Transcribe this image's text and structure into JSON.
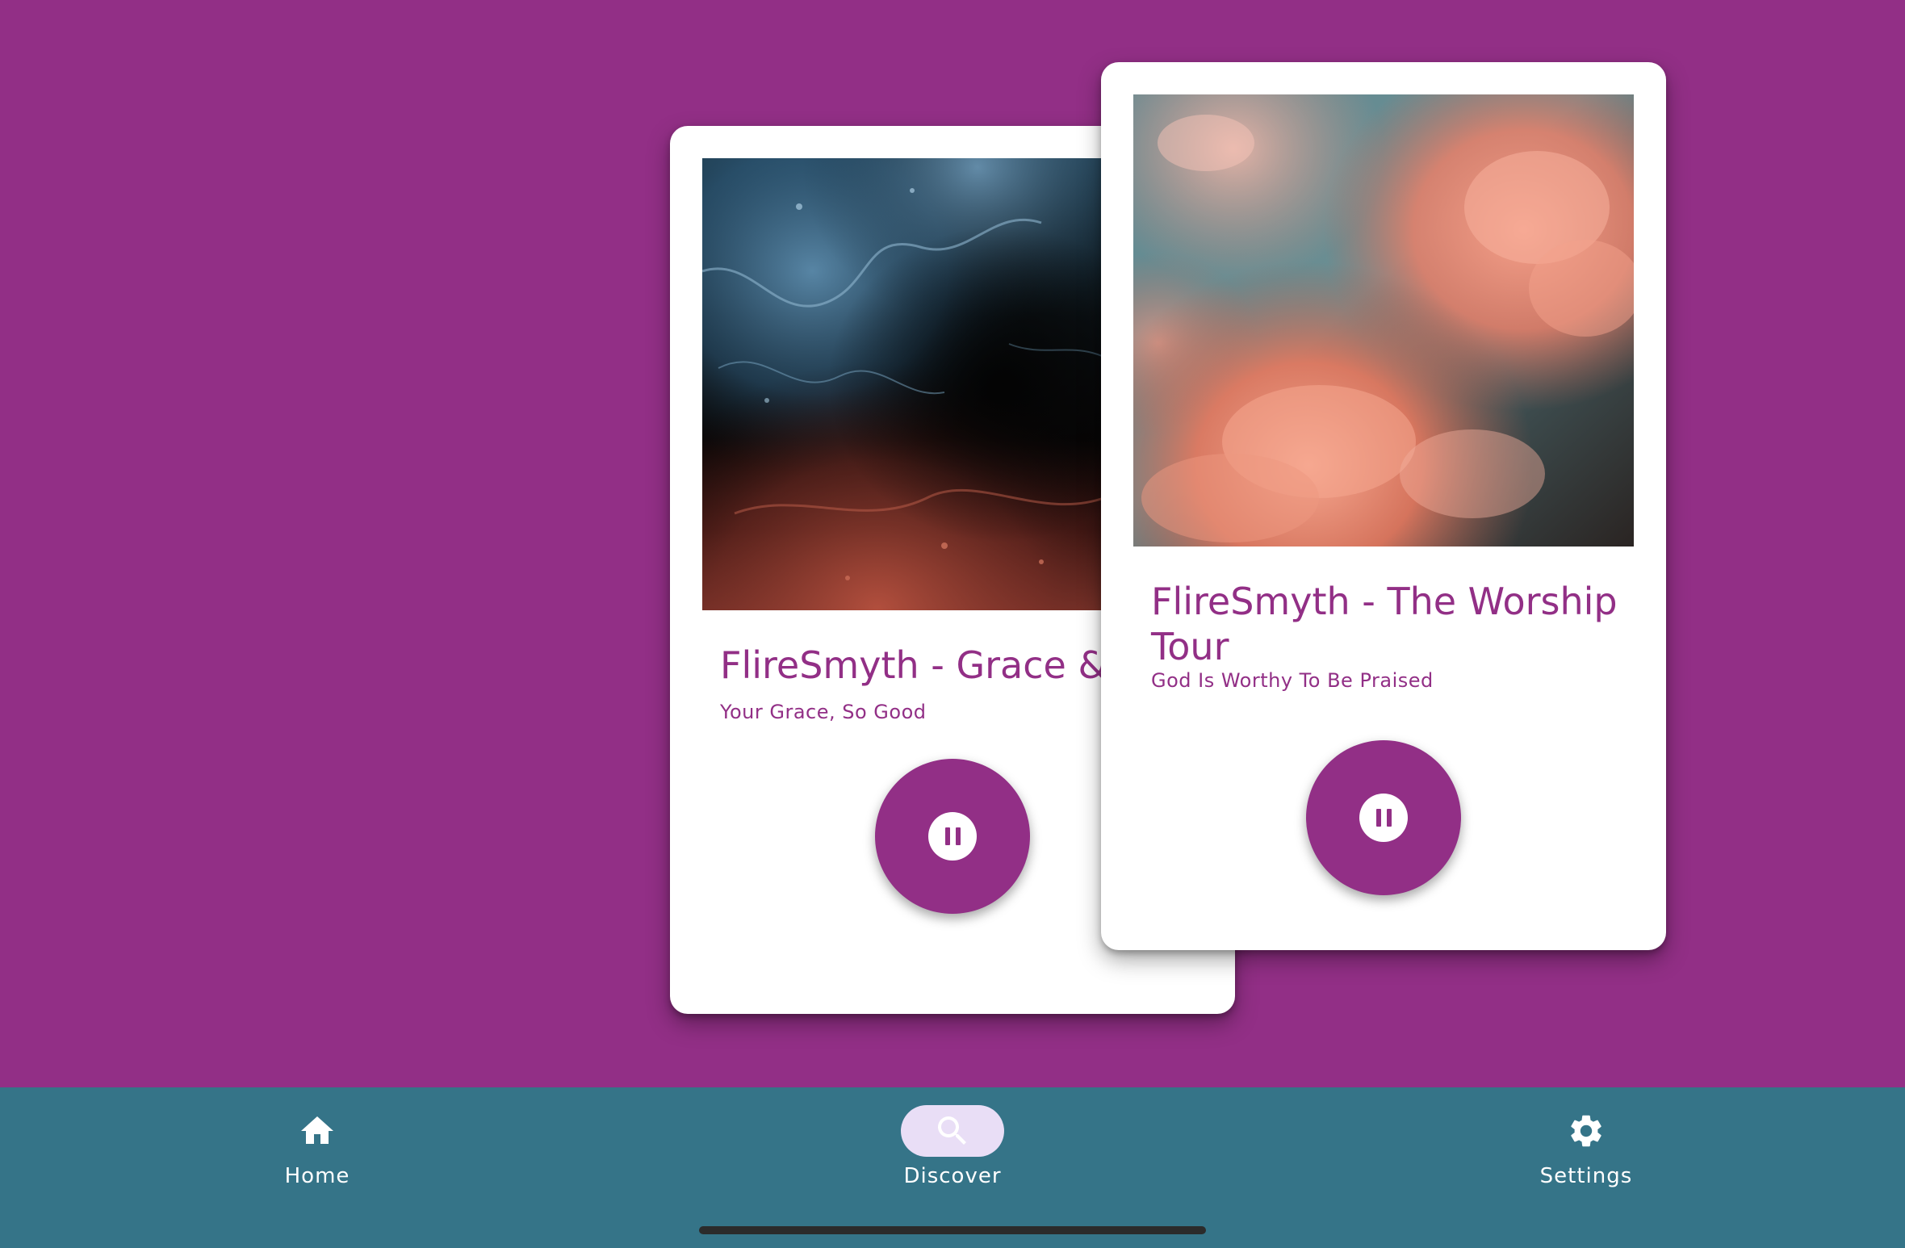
{
  "colors": {
    "background": "#922F86",
    "card": "#FFFFFF",
    "accent": "#922F86",
    "nav_bar": "#357488",
    "nav_active_pill": "#E9DEF6",
    "nav_text": "#FFFFFF",
    "home_indicator": "#2B2B2B"
  },
  "cards": [
    {
      "title": "FlireSmyth - Grace & M",
      "subtitle": "Your Grace, So Good",
      "artwork": "abstract-blue-red-paint-image",
      "control_icon": "pause-icon"
    },
    {
      "title": "FlireSmyth - The Worship Tour",
      "subtitle": "God Is Worthy To Be Praised",
      "artwork": "pink-clouds-sky-image",
      "control_icon": "pause-icon"
    }
  ],
  "bottom_nav": {
    "selected": "Discover",
    "items": [
      {
        "label": "Home",
        "icon": "home-icon"
      },
      {
        "label": "Discover",
        "icon": "search-icon"
      },
      {
        "label": "Settings",
        "icon": "gear-icon"
      }
    ]
  }
}
